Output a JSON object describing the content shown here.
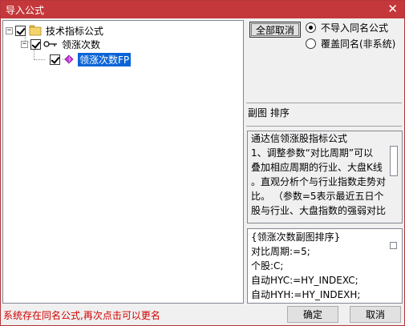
{
  "window": {
    "title": "导入公式",
    "close_glyph": "✕"
  },
  "tree": {
    "root": {
      "label": "技术指标公式",
      "expander": "−"
    },
    "child": {
      "label": "领涨次数",
      "expander": "−"
    },
    "leaf": {
      "label": "领涨次数FP"
    }
  },
  "options": {
    "select_all_label": "全部取消",
    "radio_skip_label": "不导入同名公式",
    "radio_overwrite_label": "覆盖同名(非系统)",
    "selected": "不导入同名公式"
  },
  "secondary_label": "副图 排序",
  "description": {
    "lines": [
      "通达信领涨股指标公式",
      "1、调整参数“对比周期”可以",
      "叠加相应周期的行业、大盘K线",
      "。直观分析个与行业指数走势对",
      "比。 （参数=5表示最近五日个",
      "股与行业、大盘指数的强弱对比"
    ]
  },
  "code": {
    "lines": [
      "{领涨次数副图排序}",
      "对比周期:=5;",
      "个股:C;",
      "自动HYC:=HY_INDEXC;",
      "自动HYH:=HY_INDEXH;"
    ]
  },
  "footer": {
    "status": "系统存在同名公式,再次点击可以更名",
    "ok_label": "确定",
    "cancel_label": "取消"
  },
  "colors": {
    "titlebar": "#c4373b",
    "selection": "#0a64d8",
    "status_text": "#d40000"
  }
}
